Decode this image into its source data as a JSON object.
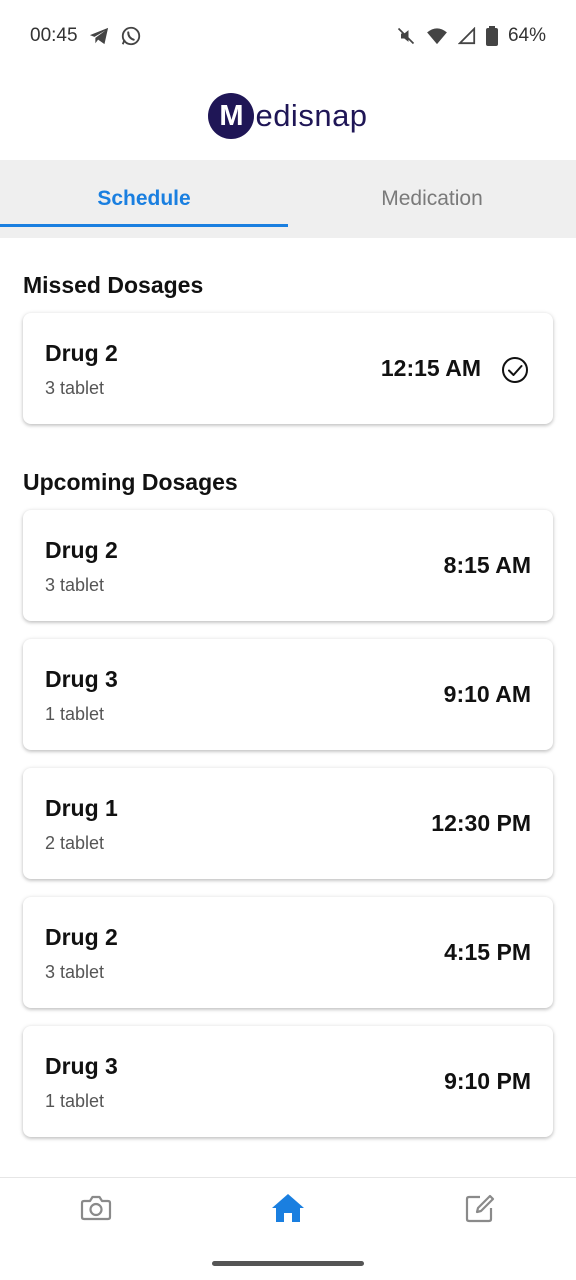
{
  "status_bar": {
    "time": "00:45",
    "battery": "64%",
    "icons": [
      "telegram-icon",
      "whatsapp-icon",
      "mute-icon",
      "wifi-icon",
      "signal-icon",
      "battery-icon"
    ]
  },
  "header": {
    "logo_letter": "M",
    "logo_text": "edisnap",
    "brand_color": "#1f1656"
  },
  "tabs": [
    {
      "label": "Schedule",
      "active": true
    },
    {
      "label": "Medication",
      "active": false
    }
  ],
  "accent_color": "#1a7fe0",
  "missed": {
    "title": "Missed Dosages",
    "items": [
      {
        "drug": "Drug 2",
        "dose": "3 tablet",
        "time": "12:15 AM",
        "icon": "check-circle-icon"
      }
    ]
  },
  "upcoming": {
    "title": "Upcoming Dosages",
    "items": [
      {
        "drug": "Drug 2",
        "dose": "3 tablet",
        "time": "8:15 AM"
      },
      {
        "drug": "Drug 3",
        "dose": "1 tablet",
        "time": "9:10 AM"
      },
      {
        "drug": "Drug 1",
        "dose": "2 tablet",
        "time": "12:30 PM"
      },
      {
        "drug": "Drug 2",
        "dose": "3 tablet",
        "time": "4:15 PM"
      },
      {
        "drug": "Drug 3",
        "dose": "1 tablet",
        "time": "9:10 PM"
      }
    ]
  },
  "bottom_nav": [
    {
      "icon": "camera-icon",
      "active": false
    },
    {
      "icon": "home-icon",
      "active": true
    },
    {
      "icon": "edit-icon",
      "active": false
    }
  ]
}
